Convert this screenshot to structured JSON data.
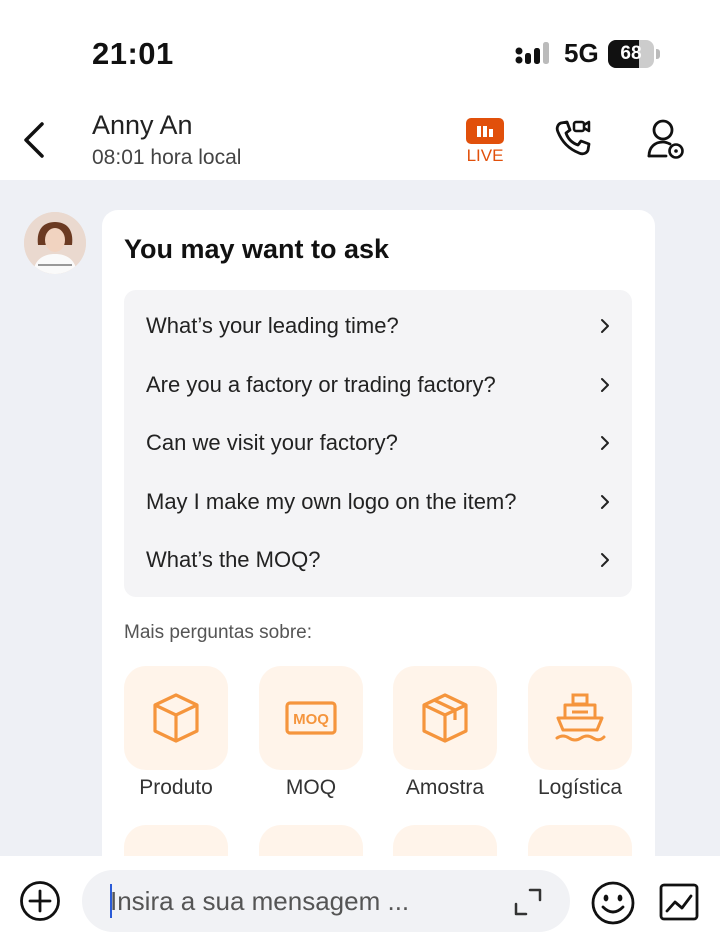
{
  "status_bar": {
    "time": "21:01",
    "network": "5G",
    "battery": "68",
    "battery_percent": 68
  },
  "header": {
    "contact_name": "Anny An",
    "local_time": "08:01 hora local",
    "live_label": "LIVE",
    "icons": {
      "back": "chevron-left-icon",
      "live": "live-stream-icon",
      "video_call": "video-phone-icon",
      "profile": "user-settings-icon"
    }
  },
  "suggestions": {
    "title": "You may want to ask",
    "questions": [
      "What’s your leading time?",
      "Are you a factory or trading factory?",
      "Can we visit your factory?",
      "May I make my own logo on the item?",
      "What’s the MOQ?"
    ],
    "more_label": "Mais perguntas sobre:",
    "topics": [
      {
        "label": "Produto",
        "icon": "box-icon"
      },
      {
        "label": "MOQ",
        "icon": "moq-icon",
        "icon_text": "MOQ"
      },
      {
        "label": "Amostra",
        "icon": "sample-box-icon"
      },
      {
        "label": "Logística",
        "icon": "ship-icon"
      }
    ]
  },
  "composer": {
    "placeholder": "Insira a sua mensagem ...",
    "icons": {
      "add": "plus-circle-icon",
      "expand": "expand-icon",
      "emoji": "smiley-icon",
      "sticker": "sticker-icon"
    }
  },
  "colors": {
    "accent": "#e1500b",
    "topic_icon": "#f5953d",
    "topic_tile": "#fff4ea",
    "chat_background": "#eef0f5",
    "caret": "#2a5bd7"
  }
}
